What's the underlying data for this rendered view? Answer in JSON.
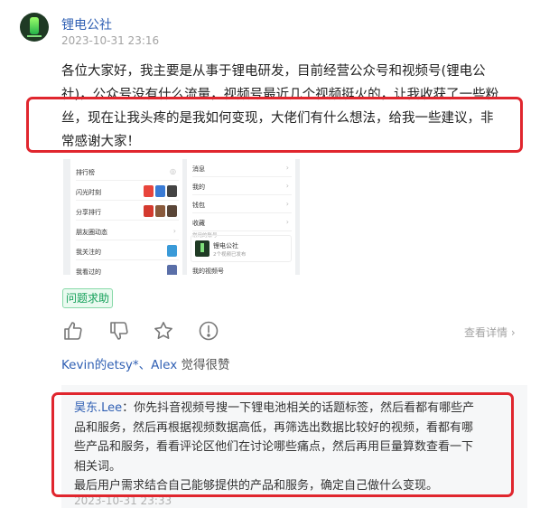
{
  "post": {
    "author": "锂电公社",
    "date": "2023-10-31 23:16",
    "lines": [
      "各位大家好，我主要是从事于锂电研发，目前经营公众号和视频号(锂电公",
      "社)，公众号没有什么流量，视频号最近几个视频挺火的，让我收获了一些粉",
      "丝，现在让我头疼的是我如何变现，大佬们有什么想法，给我一些建议，非",
      "常感谢大家！"
    ],
    "tag": "问题求助"
  },
  "screenshot": {
    "left_rows": [
      "排行榜",
      "闪光时刻",
      "分享排行",
      "朋友圈动态",
      "我关注的",
      "我看过的"
    ],
    "right_rows": [
      "消息",
      "我的",
      "钱包",
      "收藏"
    ],
    "right_note": "常用的账号",
    "account_name": "锂电公社",
    "account_sub": "2个视频已发布",
    "right_bottom": "我的视频号"
  },
  "actions": {
    "icons": [
      "thumbs-up-icon",
      "thumbs-down-icon",
      "star-icon",
      "report-icon"
    ],
    "more_label": "查看详情 ›"
  },
  "likes": {
    "names": "Kevin的etsy*、Alex",
    "suffix": " 觉得很赞"
  },
  "comment": {
    "user": "昊东.Lee",
    "lines": [
      "：你先抖音视频号搜一下锂电池相关的话题标签，然后看都有哪些产",
      "品和服务，然后再根据视频数据高低，再筛选出数据比较好的视频，看都有哪",
      "些产品和服务，看看评论区他们在讨论哪些痛点，然后再用巨量算数查看一下",
      "相关词。",
      "最后用户需求结合自己能够提供的产品和服务，确定自己做什么变现。"
    ],
    "date": "2023-10-31 23:33"
  },
  "colors": {
    "link": "#2f5fb3",
    "highlight": "#e0262e",
    "tag": "#15a05a"
  }
}
